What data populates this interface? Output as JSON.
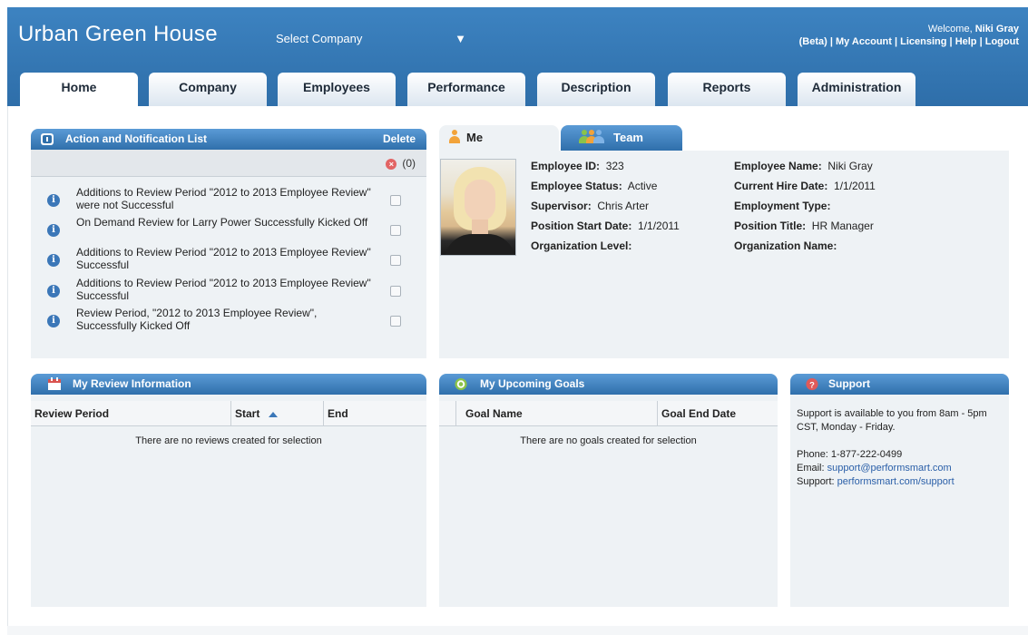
{
  "app": {
    "title": "Urban Green House"
  },
  "company_select": {
    "value": "Select Company",
    "caret": "▼"
  },
  "user": {
    "welcome_prefix": "Welcome, ",
    "name": "Niki Gray",
    "links": [
      "(Beta)",
      "My Account",
      "Licensing",
      "Help",
      "Logout"
    ]
  },
  "nav": {
    "tabs": [
      "Home",
      "Company",
      "Employees",
      "Performance",
      "Description",
      "Reports",
      "Administration"
    ],
    "active": "Home"
  },
  "notifications": {
    "title": "Action and Notification List",
    "delete_label": "Delete",
    "count": "(0)",
    "items": [
      "Additions to Review Period \"2012 to 2013 Employee Review\" were not Successful",
      "On Demand Review for Larry Power Successfully Kicked Off",
      "Additions to Review Period \"2012 to 2013 Employee Review\" Successful",
      "Additions to Review Period \"2012 to 2013 Employee Review\" Successful",
      "Review Period, \"2012 to 2013 Employee Review\", Successfully Kicked Off"
    ]
  },
  "profile_tabs": {
    "me": "Me",
    "team": "Team"
  },
  "employee": {
    "id_label": "Employee ID:",
    "id": "323",
    "status_label": "Employee Status:",
    "status": "Active",
    "supervisor_label": "Supervisor:",
    "supervisor": "Chris Arter",
    "position_start_label": "Position Start Date:",
    "position_start": "1/1/2011",
    "org_level_label": "Organization Level:",
    "org_level": "",
    "name_label": "Employee Name:",
    "name": "Niki Gray",
    "hire_date_label": "Current Hire Date:",
    "hire_date": "1/1/2011",
    "employment_type_label": "Employment Type:",
    "employment_type": "",
    "position_title_label": "Position Title:",
    "position_title": "HR Manager",
    "org_name_label": "Organization Name:",
    "org_name": ""
  },
  "reviews": {
    "title": "My Review Information",
    "columns": [
      "Review Period",
      "Start",
      "End"
    ],
    "empty": "There are no reviews created for selection"
  },
  "goals": {
    "title": "My Upcoming Goals",
    "columns": [
      "Goal Name",
      "Goal End Date"
    ],
    "empty": "There are no goals created for selection"
  },
  "support": {
    "title": "Support",
    "hours": "Support is available to you from 8am - 5pm CST, Monday - Friday.",
    "phone": "Phone: 1-877-222-0499",
    "email_label": "Email: ",
    "email": "support@performsmart.com",
    "support_label": "Support: ",
    "support_link": "performsmart.com/support"
  },
  "colors": {
    "header_blue": "#3d83c1",
    "panel_head": "#2f6fab",
    "panel_body": "#eef2f5",
    "link": "#2a5fa8"
  }
}
